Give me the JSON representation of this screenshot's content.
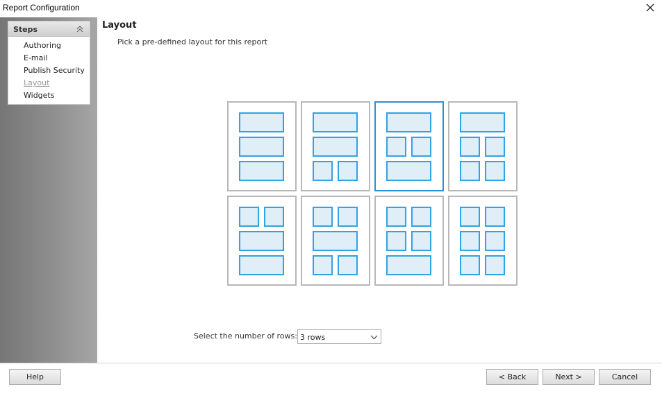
{
  "window": {
    "title": "Report Configuration"
  },
  "steps": {
    "header": "Steps",
    "items": [
      {
        "label": "Authoring",
        "current": false
      },
      {
        "label": "E-mail",
        "current": false
      },
      {
        "label": "Publish Security",
        "current": false
      },
      {
        "label": "Layout",
        "current": true
      },
      {
        "label": "Widgets",
        "current": false
      }
    ]
  },
  "main": {
    "title": "Layout",
    "subtitle": "Pick a pre-defined layout for this report"
  },
  "layouts": {
    "selected_index": 2,
    "options": [
      [
        "full",
        "full",
        "full"
      ],
      [
        "full",
        "full",
        "split"
      ],
      [
        "full",
        "split",
        "full"
      ],
      [
        "full",
        "split",
        "split"
      ],
      [
        "split",
        "full",
        "full"
      ],
      [
        "split",
        "full",
        "split"
      ],
      [
        "split",
        "split",
        "full"
      ],
      [
        "split",
        "split",
        "split"
      ]
    ]
  },
  "rows": {
    "label": "Select the number of rows:",
    "selected": "3 rows"
  },
  "buttons": {
    "help": "Help",
    "back": "< Back",
    "next": "Next >",
    "cancel": "Cancel"
  },
  "colors": {
    "accent": "#2ea3e6",
    "selected_border": "#2b8fd6",
    "cell_fill": "#dfeef7"
  },
  "icons": {
    "close": "close-icon",
    "collapse": "double-chevron-up-icon",
    "dropdown": "chevron-down-icon"
  }
}
